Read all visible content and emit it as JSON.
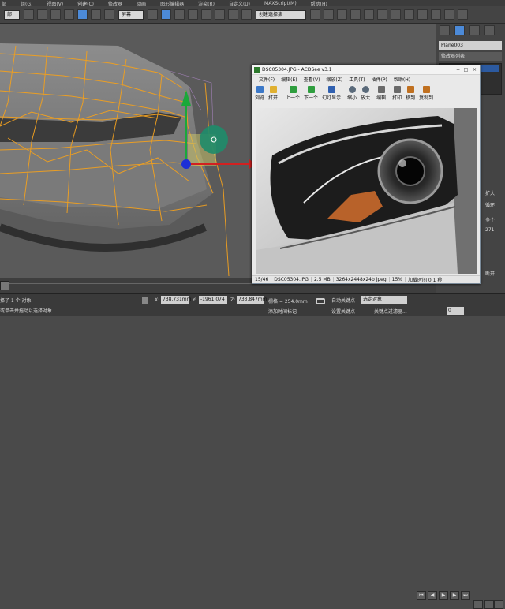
{
  "app": {
    "menu": [
      "部",
      "组(G)",
      "视图(V)",
      "创建(C)",
      "修改器",
      "动画",
      "图形编辑器",
      "渲染(R)",
      "自定义(U)",
      "MAXScript(M)",
      "帮助(H)"
    ],
    "toolbar": {
      "filter_dropdown": "部",
      "coord_dropdown": "屏幕",
      "selection_set": "创建选择集"
    }
  },
  "right_panel": {
    "object_name": "Plane003",
    "modifier_list_label": "修改器列表",
    "labels": [
      "扩大",
      "循环",
      "多个",
      "271",
      "断开"
    ]
  },
  "acdsee": {
    "title": "DSC05304.JPG - ACDSee v3.1",
    "menu": [
      "文件(F)",
      "编辑(E)",
      "查看(V)",
      "缩放(Z)",
      "工具(T)",
      "插件(P)",
      "帮助(H)"
    ],
    "tools": [
      {
        "label": "浏览",
        "icon": "browse-icon",
        "color": "#3b78c8"
      },
      {
        "label": "打开",
        "icon": "open-folder-icon",
        "color": "#e0b030"
      },
      {
        "label": "上一个",
        "icon": "previous-icon",
        "color": "#2e9e3e"
      },
      {
        "label": "下一个",
        "icon": "next-icon",
        "color": "#2e9e3e"
      },
      {
        "label": "幻灯显示",
        "icon": "slideshow-icon",
        "color": "#3060b0"
      },
      {
        "label": "缩小",
        "icon": "zoom-out-icon",
        "color": "#5a6a7a"
      },
      {
        "label": "放大",
        "icon": "zoom-in-icon",
        "color": "#5a6a7a"
      },
      {
        "label": "编辑",
        "icon": "edit-icon",
        "color": "#6a6a6a"
      },
      {
        "label": "打印",
        "icon": "print-icon",
        "color": "#6a6a6a"
      },
      {
        "label": "移到",
        "icon": "move-to-icon",
        "color": "#c07020"
      },
      {
        "label": "复制到",
        "icon": "copy-to-icon",
        "color": "#c07020"
      }
    ],
    "status": [
      "15/46",
      "DSC05304.JPG",
      "2.5 MB",
      "3264x2448x24b jpeg",
      "15%",
      "加载时间 0.1 秒"
    ]
  },
  "statusbar": {
    "selection": "择了 1 个 对象",
    "prompt": "或单击并拖动以选择对象",
    "x_label": "X:",
    "x_value": "738.731mm",
    "y_label": "Y:",
    "y_value": "-1961.074",
    "z_label": "Z:",
    "z_value": "733.847mm",
    "grid": "栅格 = 254.0mm",
    "auto_key": "自动关键点",
    "selected_dropdown": "选定对象",
    "set_key": "设置关键点",
    "key_filter": "关键点过滤器...",
    "add_time_tag": "添加时间标记",
    "frame": "0"
  },
  "colors": {
    "wire": "#f0a020",
    "gizmo_green": "#1aa83a",
    "gizmo_blue": "#1d2fd6",
    "gizmo_red": "#d22020"
  }
}
